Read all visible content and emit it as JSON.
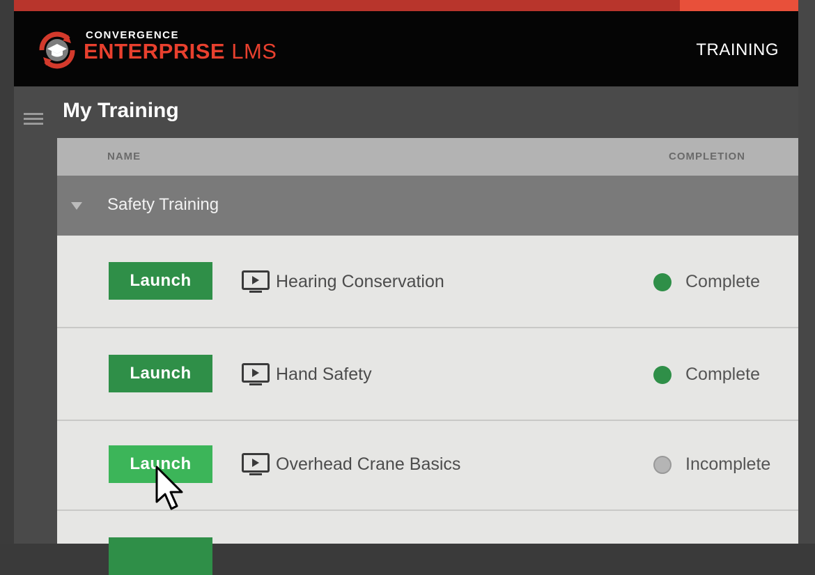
{
  "header": {
    "brand_top": "CONVERGENCE",
    "brand_main": "ENTERPRISE",
    "brand_suffix": "LMS",
    "nav_label": "TRAINING",
    "accent_color": "#e8402e"
  },
  "page": {
    "title": "My Training",
    "menu_icon": "hamburger-icon"
  },
  "table": {
    "columns": [
      "NAME",
      "COMPLETION"
    ],
    "group": {
      "label": "Safety Training",
      "expanded": true,
      "icon": "triangle-down-icon"
    },
    "rows": [
      {
        "button": "Launch",
        "icon": "video-icon",
        "course": "Hearing Conservation",
        "status": "Complete",
        "status_color": "#2f8f48"
      },
      {
        "button": "Launch",
        "icon": "video-icon",
        "course": "Hand Safety",
        "status": "Complete",
        "status_color": "#2f8f48"
      },
      {
        "button": "Launch",
        "icon": "video-icon",
        "course": "Overhead Crane Basics",
        "status": "Incomplete",
        "status_color": "#b5b5b5"
      }
    ]
  }
}
